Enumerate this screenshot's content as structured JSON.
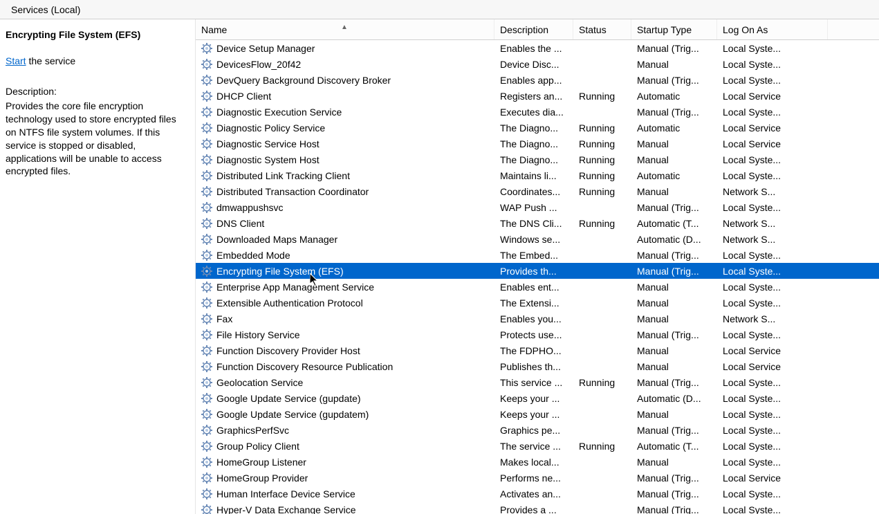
{
  "header": {
    "title": "Services (Local)"
  },
  "sidebar": {
    "selected_title": "Encrypting File System (EFS)",
    "start_link": "Start",
    "start_rest": " the service",
    "desc_label": "Description:",
    "desc_body": "Provides the core file encryption technology used to store encrypted files on NTFS file system volumes. If this service is stopped or disabled, applications will be unable to access encrypted files."
  },
  "columns": {
    "name": "Name",
    "desc": "Description",
    "status": "Status",
    "start": "Startup Type",
    "logon": "Log On As"
  },
  "sort_glyph": "▲",
  "services": [
    {
      "name": "Device Setup Manager",
      "desc": "Enables the ...",
      "status": "",
      "start": "Manual (Trig...",
      "logon": "Local Syste..."
    },
    {
      "name": "DevicesFlow_20f42",
      "desc": "Device Disc...",
      "status": "",
      "start": "Manual",
      "logon": "Local Syste..."
    },
    {
      "name": "DevQuery Background Discovery Broker",
      "desc": "Enables app...",
      "status": "",
      "start": "Manual (Trig...",
      "logon": "Local Syste..."
    },
    {
      "name": "DHCP Client",
      "desc": "Registers an...",
      "status": "Running",
      "start": "Automatic",
      "logon": "Local Service"
    },
    {
      "name": "Diagnostic Execution Service",
      "desc": "Executes dia...",
      "status": "",
      "start": "Manual (Trig...",
      "logon": "Local Syste..."
    },
    {
      "name": "Diagnostic Policy Service",
      "desc": "The Diagno...",
      "status": "Running",
      "start": "Automatic",
      "logon": "Local Service"
    },
    {
      "name": "Diagnostic Service Host",
      "desc": "The Diagno...",
      "status": "Running",
      "start": "Manual",
      "logon": "Local Service"
    },
    {
      "name": "Diagnostic System Host",
      "desc": "The Diagno...",
      "status": "Running",
      "start": "Manual",
      "logon": "Local Syste..."
    },
    {
      "name": "Distributed Link Tracking Client",
      "desc": "Maintains li...",
      "status": "Running",
      "start": "Automatic",
      "logon": "Local Syste..."
    },
    {
      "name": "Distributed Transaction Coordinator",
      "desc": "Coordinates...",
      "status": "Running",
      "start": "Manual",
      "logon": "Network S..."
    },
    {
      "name": "dmwappushsvc",
      "desc": "WAP Push ...",
      "status": "",
      "start": "Manual (Trig...",
      "logon": "Local Syste..."
    },
    {
      "name": "DNS Client",
      "desc": "The DNS Cli...",
      "status": "Running",
      "start": "Automatic (T...",
      "logon": "Network S..."
    },
    {
      "name": "Downloaded Maps Manager",
      "desc": "Windows se...",
      "status": "",
      "start": "Automatic (D...",
      "logon": "Network S..."
    },
    {
      "name": "Embedded Mode",
      "desc": "The Embed...",
      "status": "",
      "start": "Manual (Trig...",
      "logon": "Local Syste..."
    },
    {
      "name": "Encrypting File System (EFS)",
      "desc": "Provides th...",
      "status": "",
      "start": "Manual (Trig...",
      "logon": "Local Syste...",
      "selected": true
    },
    {
      "name": "Enterprise App Management Service",
      "desc": "Enables ent...",
      "status": "",
      "start": "Manual",
      "logon": "Local Syste..."
    },
    {
      "name": "Extensible Authentication Protocol",
      "desc": "The Extensi...",
      "status": "",
      "start": "Manual",
      "logon": "Local Syste..."
    },
    {
      "name": "Fax",
      "desc": "Enables you...",
      "status": "",
      "start": "Manual",
      "logon": "Network S..."
    },
    {
      "name": "File History Service",
      "desc": "Protects use...",
      "status": "",
      "start": "Manual (Trig...",
      "logon": "Local Syste..."
    },
    {
      "name": "Function Discovery Provider Host",
      "desc": "The FDPHO...",
      "status": "",
      "start": "Manual",
      "logon": "Local Service"
    },
    {
      "name": "Function Discovery Resource Publication",
      "desc": "Publishes th...",
      "status": "",
      "start": "Manual",
      "logon": "Local Service"
    },
    {
      "name": "Geolocation Service",
      "desc": "This service ...",
      "status": "Running",
      "start": "Manual (Trig...",
      "logon": "Local Syste..."
    },
    {
      "name": "Google Update Service (gupdate)",
      "desc": "Keeps your ...",
      "status": "",
      "start": "Automatic (D...",
      "logon": "Local Syste..."
    },
    {
      "name": "Google Update Service (gupdatem)",
      "desc": "Keeps your ...",
      "status": "",
      "start": "Manual",
      "logon": "Local Syste..."
    },
    {
      "name": "GraphicsPerfSvc",
      "desc": "Graphics pe...",
      "status": "",
      "start": "Manual (Trig...",
      "logon": "Local Syste..."
    },
    {
      "name": "Group Policy Client",
      "desc": "The service ...",
      "status": "Running",
      "start": "Automatic (T...",
      "logon": "Local Syste..."
    },
    {
      "name": "HomeGroup Listener",
      "desc": "Makes local...",
      "status": "",
      "start": "Manual",
      "logon": "Local Syste..."
    },
    {
      "name": "HomeGroup Provider",
      "desc": "Performs ne...",
      "status": "",
      "start": "Manual (Trig...",
      "logon": "Local Service"
    },
    {
      "name": "Human Interface Device Service",
      "desc": "Activates an...",
      "status": "",
      "start": "Manual (Trig...",
      "logon": "Local Syste..."
    },
    {
      "name": "Hyper-V Data Exchange Service",
      "desc": "Provides a ...",
      "status": "",
      "start": "Manual (Trig...",
      "logon": "Local Syste..."
    }
  ]
}
